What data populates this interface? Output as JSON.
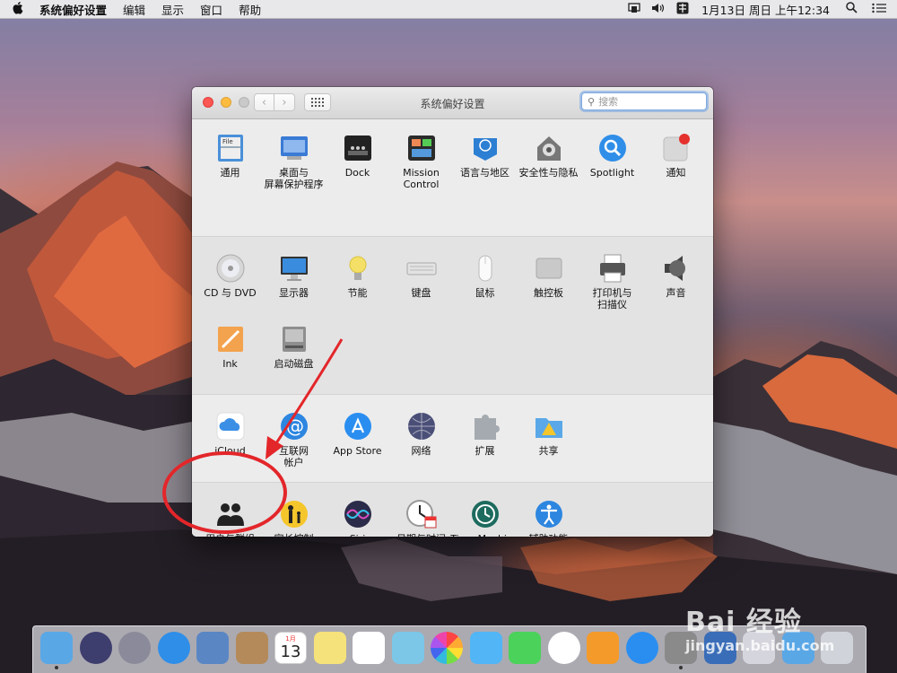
{
  "menubar": {
    "app": "系统偏好设置",
    "menus": [
      "编辑",
      "显示",
      "窗口",
      "帮助"
    ],
    "clock": "1月13日 周日 上午12:34"
  },
  "window": {
    "title": "系统偏好设置",
    "search_placeholder": "搜索"
  },
  "sections": [
    {
      "rows": [
        [
          {
            "icon": "general-icon",
            "label": "通用"
          },
          {
            "icon": "desktop-screensaver-icon",
            "label": "桌面与\n屏幕保护程序"
          },
          {
            "icon": "dock-icon",
            "label": "Dock"
          },
          {
            "icon": "mission-control-icon",
            "label": "Mission\nControl"
          },
          {
            "icon": "language-region-icon",
            "label": "语言与地区"
          },
          {
            "icon": "security-privacy-icon",
            "label": "安全性与隐私"
          },
          {
            "icon": "spotlight-icon",
            "label": "Spotlight"
          },
          {
            "icon": "notifications-icon",
            "label": "通知"
          }
        ]
      ]
    },
    {
      "rows": [
        [
          {
            "icon": "cd-dvd-icon",
            "label": "CD 与 DVD"
          },
          {
            "icon": "displays-icon",
            "label": "显示器"
          },
          {
            "icon": "energy-saver-icon",
            "label": "节能"
          },
          {
            "icon": "keyboard-icon",
            "label": "键盘"
          },
          {
            "icon": "mouse-icon",
            "label": "鼠标"
          },
          {
            "icon": "trackpad-icon",
            "label": "触控板"
          },
          {
            "icon": "printer-scanner-icon",
            "label": "打印机与\n扫描仪"
          },
          {
            "icon": "sound-icon",
            "label": "声音"
          }
        ],
        [
          {
            "icon": "ink-icon",
            "label": "Ink"
          },
          {
            "icon": "startup-disk-icon",
            "label": "启动磁盘"
          }
        ]
      ]
    },
    {
      "rows": [
        [
          {
            "icon": "icloud-icon",
            "label": "iCloud"
          },
          {
            "icon": "internet-accounts-icon",
            "label": "互联网\n帐户"
          },
          {
            "icon": "app-store-icon",
            "label": "App Store"
          },
          {
            "icon": "network-icon",
            "label": "网络"
          },
          {
            "icon": "extensions-icon",
            "label": "扩展"
          },
          {
            "icon": "sharing-icon",
            "label": "共享"
          }
        ]
      ]
    },
    {
      "rows": [
        [
          {
            "icon": "users-groups-icon",
            "label": "用户与群组"
          },
          {
            "icon": "parental-controls-icon",
            "label": "家长控制"
          },
          {
            "icon": "siri-icon",
            "label": "Siri"
          },
          {
            "icon": "date-time-icon",
            "label": "日期与时间"
          },
          {
            "icon": "time-machine-icon",
            "label": "Time Machine"
          },
          {
            "icon": "accessibility-icon",
            "label": "辅助功能"
          }
        ]
      ]
    }
  ],
  "dock": {
    "apps": [
      "finder-icon",
      "siri-icon",
      "launchpad-icon",
      "safari-icon",
      "mail-icon",
      "contacts-icon",
      "calendar-icon",
      "notes-icon",
      "reminders-icon",
      "maps-icon",
      "photos-icon",
      "messages-icon",
      "facetime-icon",
      "itunes-icon",
      "ibooks-icon",
      "app-store-icon",
      "system-preferences-icon",
      "unknown-app-icon",
      "unknown-app-icon-2",
      "downloads-icon",
      "trash-icon"
    ],
    "calendar_day": "13",
    "calendar_month": "1月"
  },
  "watermark": {
    "brand": "Bai 经验",
    "url": "jingyan.baidu.com"
  }
}
